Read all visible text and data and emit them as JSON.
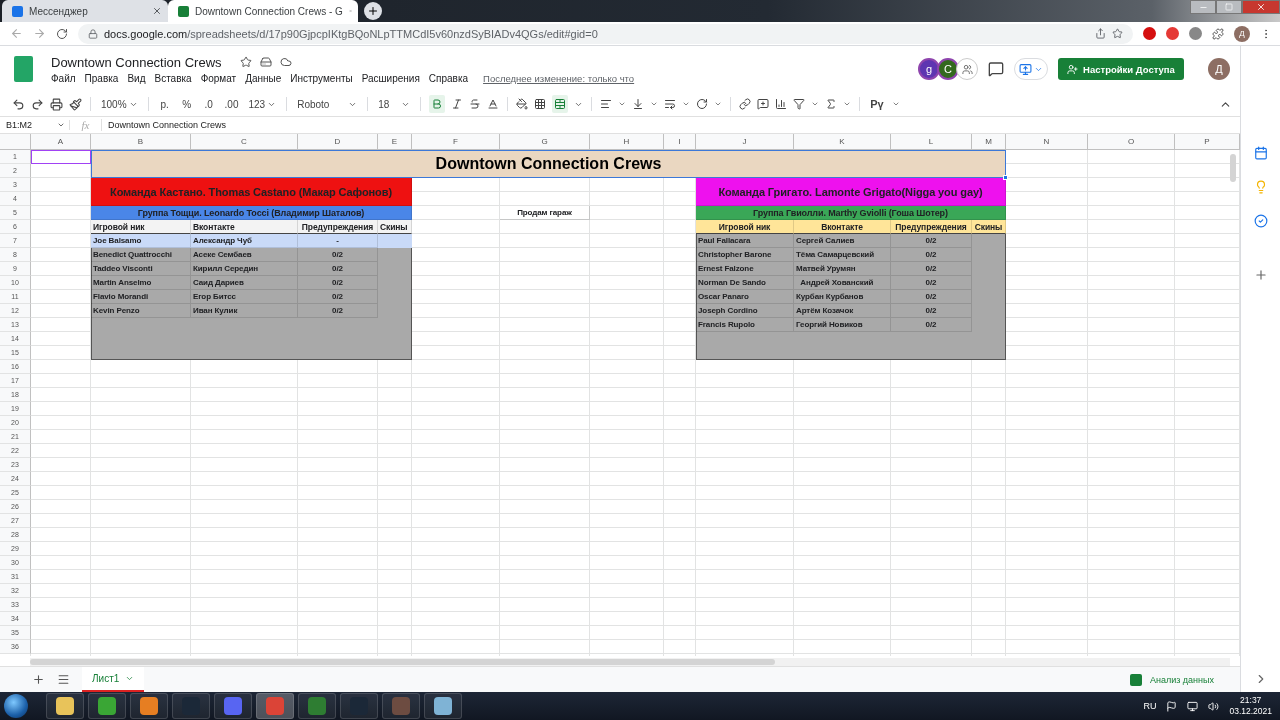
{
  "browser": {
    "tabs": [
      {
        "title": "Мессенджер",
        "selected": false
      },
      {
        "title": "Downtown Connection Crews - G",
        "selected": true
      }
    ],
    "url_host": "docs.google.com",
    "url_path": "/spreadsheets/d/17p90GjpcpIKtgBQoNLpTTMCdI5v60nzdSyBIADv4QGs/edit#gid=0",
    "profile_initial": "Д"
  },
  "app": {
    "doc_title": "Downtown Connection Crews",
    "menu": [
      "Файл",
      "Правка",
      "Вид",
      "Вставка",
      "Формат",
      "Данные",
      "Инструменты",
      "Расширения",
      "Справка"
    ],
    "last_edit": "Последнее изменение: только что",
    "collaborators": [
      {
        "initial": "g",
        "color": "#5e35b1"
      },
      {
        "initial": "С",
        "color": "#33691e"
      }
    ],
    "share_button": "Настройки Доступа",
    "account_initial": "Д"
  },
  "toolbar": {
    "zoom": "100%",
    "currency": "р.",
    "percent": "%",
    "decimals_less": ".0",
    "decimals_more": ".00",
    "number_format": "123",
    "font": "Roboto",
    "font_size": "18",
    "bold": true,
    "merge": true,
    "input_tools": "Рү"
  },
  "formula_bar": {
    "cell_ref": "B1:M2",
    "fx": "fx",
    "value": "Downtown Connection Crews"
  },
  "sheet": {
    "columns": [
      "A",
      "B",
      "C",
      "D",
      "E",
      "F",
      "G",
      "H",
      "I",
      "J",
      "K",
      "L",
      "M",
      "N",
      "O",
      "P"
    ],
    "row_numbers": [
      "1",
      "2",
      "3",
      "4",
      "5",
      "6",
      "7",
      "8",
      "9",
      "10",
      "11",
      "12",
      "13",
      "14",
      "15",
      "16",
      "17",
      "18",
      "19",
      "20",
      "21",
      "22",
      "23",
      "24",
      "25",
      "26",
      "27",
      "28",
      "29",
      "30",
      "31",
      "32",
      "33",
      "34",
      "35",
      "36"
    ],
    "title": "Downtown Connection Crews",
    "note": "Продам гараж",
    "teams": [
      {
        "name": "Команда Кастано. Thomas Castano (Макар Сафонов)",
        "color": "#ee1111",
        "group": {
          "text": "Группа Тощци. Leonardo Tocci (Владимир Шаталов)",
          "color": "#4a86e8"
        },
        "headers": {
          "color": "#f3f3f3",
          "labels": [
            "Игровой ник",
            "Вконтакте",
            "Предупреждения",
            "Скины"
          ]
        },
        "rows": [
          {
            "cells": [
              "Joe Balsamo",
              "Александр Чуб",
              "-"
            ],
            "highlight": true
          },
          {
            "cells": [
              "Benedict Quattrocchi",
              "Асеке Сембаев",
              "0/2"
            ],
            "highlight": false
          },
          {
            "cells": [
              "Taddeo Visconti",
              "Кирилл Середин",
              "0/2"
            ],
            "highlight": false
          },
          {
            "cells": [
              "Martin Anselmo",
              "Саид Дариев",
              "0/2"
            ],
            "highlight": false
          },
          {
            "cells": [
              "Flavio Morandi",
              "Егор Битсс",
              "0/2"
            ],
            "highlight": false
          },
          {
            "cells": [
              "Kevin Penzo",
              "Иван Кулик",
              "0/2"
            ],
            "highlight": false
          }
        ]
      },
      {
        "name": "Команда Григато. Lamonte Grigato(Nigga you gay)",
        "color": "#ee11ee",
        "group": {
          "text": "Группа Гвиолли. Marthy Gviolli (Гоша Шотер)",
          "color": "#3aa757"
        },
        "headers": {
          "color": "#ffe599",
          "labels": [
            "Игровой ник",
            "Вконтакте",
            "Предупреждения",
            "Скины"
          ]
        },
        "rows": [
          {
            "cells": [
              "Paul Fallacara",
              "Сергей Салиев",
              "0/2"
            ],
            "highlight": false
          },
          {
            "cells": [
              "Christopher Barone",
              "Тёма Самарцевский",
              "0/2"
            ],
            "highlight": false
          },
          {
            "cells": [
              "Ernest Falzone",
              "Матвей Урумян",
              "0/2"
            ],
            "highlight": false
          },
          {
            "cells": [
              "Norman De Sando",
              "  Андрей Хованский",
              "0/2"
            ],
            "highlight": false
          },
          {
            "cells": [
              "Oscar Panaro",
              "Курбан Курбанов",
              "0/2"
            ],
            "highlight": false
          },
          {
            "cells": [
              "Joseph Cordino",
              "Артём Козачок",
              "0/2"
            ],
            "highlight": false
          },
          {
            "cells": [
              "Francis Rupolo",
              "Георгий Новиков",
              "0/2"
            ],
            "highlight": false
          }
        ]
      }
    ]
  },
  "sheet_tabs": [
    {
      "label": "Лист1",
      "selected": true
    }
  ],
  "explore": "Анализ данных",
  "taskbar": {
    "language": "RU",
    "time": "21:37",
    "date": "03.12.2021"
  }
}
